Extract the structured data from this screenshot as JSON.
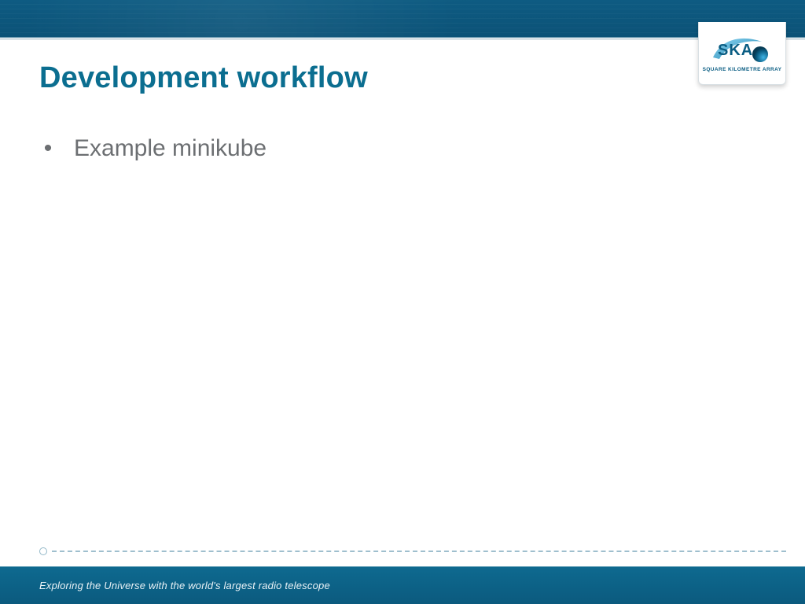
{
  "colors": {
    "title": "#0b6e90",
    "body_text": "#6c6f72",
    "band_dark": "#0b5277",
    "band_light": "#0e6a90"
  },
  "logo": {
    "text": "SKA",
    "subtext": "SQUARE KILOMETRE ARRAY"
  },
  "slide": {
    "title": "Development workflow",
    "bullets": [
      "Example minikube"
    ]
  },
  "footer": {
    "tagline": "Exploring the Universe with the world's largest radio telescope"
  }
}
